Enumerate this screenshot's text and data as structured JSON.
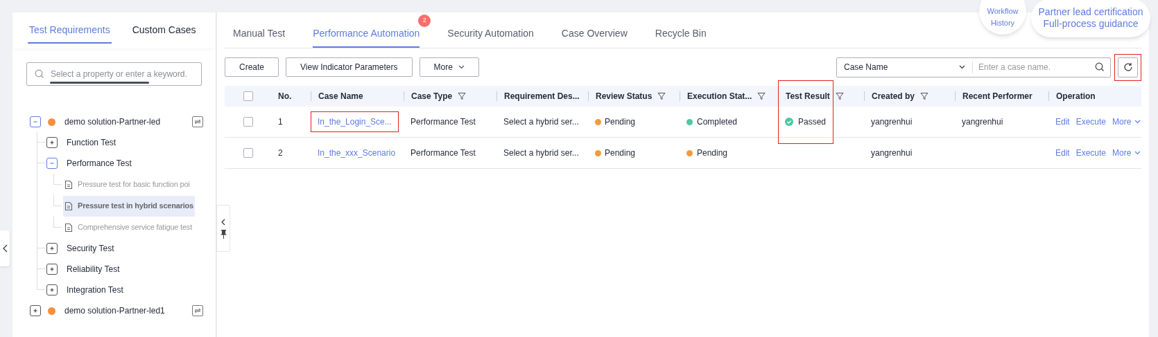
{
  "left_panel": {
    "tabs": [
      {
        "label": "Test Requirements",
        "selected": true
      },
      {
        "label": "Custom Cases",
        "selected": false
      }
    ],
    "search": {
      "placeholder": "Select a property or enter a keyword."
    },
    "tree": [
      {
        "kind": "group",
        "label": "demo solution-Partner-led",
        "expanded": true,
        "color": "#f7903a",
        "children": [
          {
            "kind": "group",
            "label": "Function Test",
            "expanded": false
          },
          {
            "kind": "group",
            "label": "Performance Test",
            "expanded": true,
            "children": [
              {
                "kind": "case",
                "label": "Pressure test for basic function poi",
                "selected": false
              },
              {
                "kind": "case",
                "label": "Pressure test in hybrid scenarios",
                "selected": true
              },
              {
                "kind": "case",
                "label": "Comprehensive service fatigue test",
                "selected": false
              }
            ]
          },
          {
            "kind": "group",
            "label": "Security Test",
            "expanded": false
          },
          {
            "kind": "group",
            "label": "Reliability Test",
            "expanded": false
          },
          {
            "kind": "group",
            "label": "Integration Test",
            "expanded": false
          }
        ]
      },
      {
        "kind": "group",
        "label": "demo solution-Partner-led1",
        "expanded": false,
        "color": "#f7903a"
      }
    ]
  },
  "tabs": [
    {
      "label": "Manual Test",
      "selected": false
    },
    {
      "label": "Performance Automation",
      "selected": true,
      "badge": "2"
    },
    {
      "label": "Security Automation",
      "selected": false
    },
    {
      "label": "Case Overview",
      "selected": false
    },
    {
      "label": "Recycle Bin",
      "selected": false
    }
  ],
  "toolbar": {
    "buttons": [
      "Create",
      "View Indicator Parameters"
    ],
    "more": "More"
  },
  "search": {
    "field": "Case Name",
    "placeholder": "Enter a case name.",
    "refresh_highlighted": true
  },
  "table": {
    "select_all_checked": false,
    "columns": [
      {
        "label": "No.",
        "filter": false
      },
      {
        "label": "Case Name",
        "filter": false
      },
      {
        "label": "Case Type",
        "filter": true
      },
      {
        "label": "Requirement Des...",
        "filter": false
      },
      {
        "label": "Review Status",
        "filter": true
      },
      {
        "label": "Execution Stat...",
        "filter": true
      },
      {
        "label": "Test Result",
        "filter": true
      },
      {
        "label": "Created by",
        "filter": true
      },
      {
        "label": "Recent Performer",
        "filter": false
      },
      {
        "label": "Operation",
        "filter": false
      }
    ],
    "rows": [
      {
        "checked": false,
        "no": "1",
        "case_name": "In_the_Login_Sce...",
        "case_name_highlighted": true,
        "case_type": "Performance Test",
        "requirement": "Select a hybrid ser...",
        "review_status": {
          "label": "Pending",
          "color": "#f39a3b"
        },
        "execution_status": {
          "label": "Completed",
          "color": "#4bc9a0"
        },
        "test_result": {
          "label": "Passed",
          "highlighted": true
        },
        "created_by": "yangrenhui",
        "recent_performer": "yangrenhui",
        "operations": [
          "Edit",
          "Execute",
          "More"
        ]
      },
      {
        "checked": false,
        "no": "2",
        "case_name": "In_the_xxx_Scenario",
        "case_name_highlighted": false,
        "case_type": "Performance Test",
        "requirement": "Select a hybrid ser...",
        "review_status": {
          "label": "Pending",
          "color": "#f39a3b"
        },
        "execution_status": {
          "label": "Pending",
          "color": "#f39a3b"
        },
        "created_by": "yangrenhui",
        "operations": [
          "Edit",
          "Execute",
          "More"
        ]
      }
    ]
  },
  "floating": [
    {
      "lines": [
        "Workflow",
        "History"
      ]
    },
    {
      "lines": [
        "Partner lead certification",
        "Full-process guidance"
      ]
    }
  ]
}
